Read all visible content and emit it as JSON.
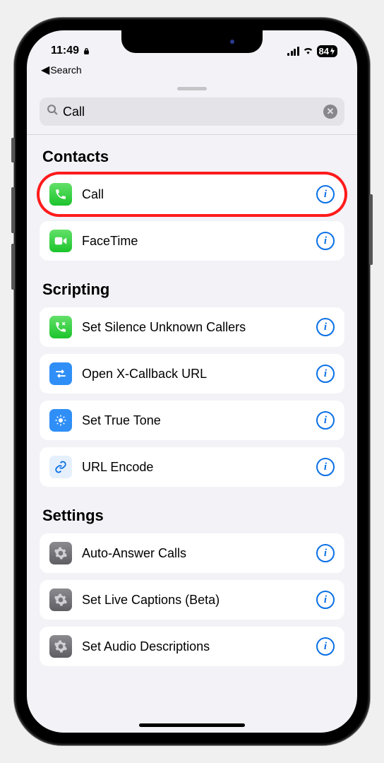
{
  "status": {
    "time": "11:49",
    "battery": "84"
  },
  "nav": {
    "back_label": "Search"
  },
  "search": {
    "value": "Call"
  },
  "sections": [
    {
      "title": "Contacts",
      "items": [
        {
          "label": "Call",
          "icon": "phone",
          "color": "green",
          "highlighted": true
        },
        {
          "label": "FaceTime",
          "icon": "video",
          "color": "green"
        }
      ]
    },
    {
      "title": "Scripting",
      "items": [
        {
          "label": "Set Silence Unknown Callers",
          "icon": "phone-silence",
          "color": "green"
        },
        {
          "label": "Open X-Callback URL",
          "icon": "arrows",
          "color": "blue-solid"
        },
        {
          "label": "Set True Tone",
          "icon": "brightness",
          "color": "blue-solid"
        },
        {
          "label": "URL Encode",
          "icon": "link",
          "color": "blue-light"
        }
      ]
    },
    {
      "title": "Settings",
      "items": [
        {
          "label": "Auto-Answer Calls",
          "icon": "gear",
          "color": "gray"
        },
        {
          "label": "Set Live Captions (Beta)",
          "icon": "gear",
          "color": "gray"
        },
        {
          "label": "Set Audio Descriptions",
          "icon": "gear",
          "color": "gray"
        }
      ]
    }
  ]
}
